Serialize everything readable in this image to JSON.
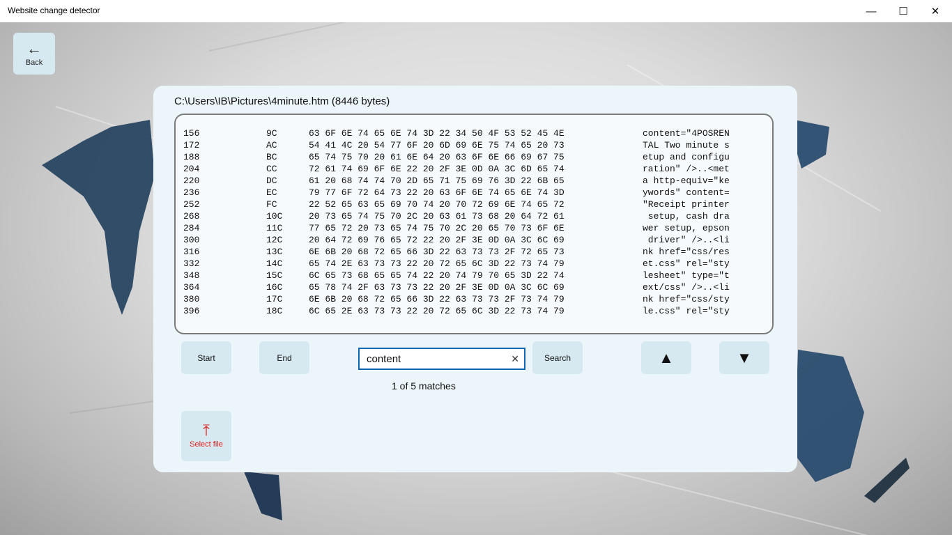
{
  "window": {
    "title": "Website change detector",
    "minimize_icon": "—",
    "maximize_icon": "☐",
    "close_icon": "✕"
  },
  "back": {
    "label": "Back",
    "icon": "←"
  },
  "file": {
    "path": "C:\\Users\\IB\\Pictures\\4minute.htm (8446 bytes)"
  },
  "hex_rows": [
    {
      "offset": "156",
      "hex": "9C",
      "bytes": "63 6F 6E 74 65 6E 74 3D 22 34 50 4F 53 52 45 4E",
      "ascii": "content=\"4POSREN"
    },
    {
      "offset": "172",
      "hex": "AC",
      "bytes": "54 41 4C 20 54 77 6F 20 6D 69 6E 75 74 65 20 73",
      "ascii": "TAL Two minute s"
    },
    {
      "offset": "188",
      "hex": "BC",
      "bytes": "65 74 75 70 20 61 6E 64 20 63 6F 6E 66 69 67 75",
      "ascii": "etup and configu"
    },
    {
      "offset": "204",
      "hex": "CC",
      "bytes": "72 61 74 69 6F 6E 22 20 2F 3E 0D 0A 3C 6D 65 74",
      "ascii": "ration\" />..<met"
    },
    {
      "offset": "220",
      "hex": "DC",
      "bytes": "61 20 68 74 74 70 2D 65 71 75 69 76 3D 22 6B 65",
      "ascii": "a http-equiv=\"ke"
    },
    {
      "offset": "236",
      "hex": "EC",
      "bytes": "79 77 6F 72 64 73 22 20 63 6F 6E 74 65 6E 74 3D",
      "ascii": "ywords\" content="
    },
    {
      "offset": "252",
      "hex": "FC",
      "bytes": "22 52 65 63 65 69 70 74 20 70 72 69 6E 74 65 72",
      "ascii": "\"Receipt printer"
    },
    {
      "offset": "268",
      "hex": "10C",
      "bytes": "20 73 65 74 75 70 2C 20 63 61 73 68 20 64 72 61",
      "ascii": " setup, cash dra"
    },
    {
      "offset": "284",
      "hex": "11C",
      "bytes": "77 65 72 20 73 65 74 75 70 2C 20 65 70 73 6F 6E",
      "ascii": "wer setup, epson"
    },
    {
      "offset": "300",
      "hex": "12C",
      "bytes": "20 64 72 69 76 65 72 22 20 2F 3E 0D 0A 3C 6C 69",
      "ascii": " driver\" />..<li"
    },
    {
      "offset": "316",
      "hex": "13C",
      "bytes": "6E 6B 20 68 72 65 66 3D 22 63 73 73 2F 72 65 73",
      "ascii": "nk href=\"css/res"
    },
    {
      "offset": "332",
      "hex": "14C",
      "bytes": "65 74 2E 63 73 73 22 20 72 65 6C 3D 22 73 74 79",
      "ascii": "et.css\" rel=\"sty"
    },
    {
      "offset": "348",
      "hex": "15C",
      "bytes": "6C 65 73 68 65 65 74 22 20 74 79 70 65 3D 22 74",
      "ascii": "lesheet\" type=\"t"
    },
    {
      "offset": "364",
      "hex": "16C",
      "bytes": "65 78 74 2F 63 73 73 22 20 2F 3E 0D 0A 3C 6C 69",
      "ascii": "ext/css\" />..<li"
    },
    {
      "offset": "380",
      "hex": "17C",
      "bytes": "6E 6B 20 68 72 65 66 3D 22 63 73 73 2F 73 74 79",
      "ascii": "nk href=\"css/sty"
    },
    {
      "offset": "396",
      "hex": "18C",
      "bytes": "6C 65 2E 63 73 73 22 20 72 65 6C 3D 22 73 74 79",
      "ascii": "le.css\" rel=\"sty"
    }
  ],
  "controls": {
    "start_label": "Start",
    "end_label": "End",
    "search_label": "Search",
    "search_value": "content",
    "clear_icon": "✕",
    "up_icon": "▲",
    "down_icon": "▼",
    "matches_text": "1 of 5 matches"
  },
  "select_file": {
    "label": "Select file",
    "icon": "⤒"
  },
  "colors": {
    "panel_bg": "#ebf5fa",
    "button_bg": "#d6e9f0",
    "input_border": "#0b67b3",
    "select_file_accent": "#e02020"
  }
}
